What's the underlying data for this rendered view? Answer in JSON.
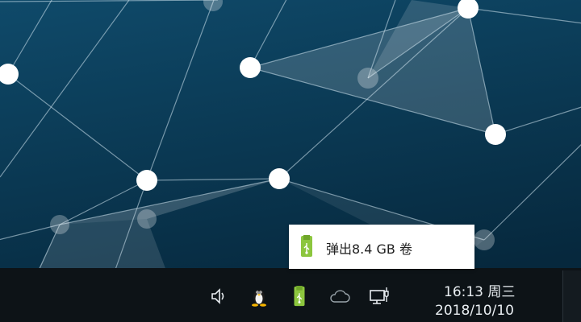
{
  "wallpaper": {
    "bg_top": "#0d4565",
    "bg_bottom": "#07293f"
  },
  "popup": {
    "icon": "usb-drive-icon",
    "label": "弹出8.4 GB 卷"
  },
  "tray": {
    "icons": [
      "volume-icon",
      "linux-penguin-icon",
      "usb-drive-icon",
      "cloud-icon",
      "network-icon"
    ]
  },
  "clock": {
    "time": "16:13 周三",
    "date": "2018/10/10"
  },
  "colors": {
    "taskbar": "#0d1317",
    "usb_green": "#8cc63e",
    "text": "#e9eef2"
  }
}
